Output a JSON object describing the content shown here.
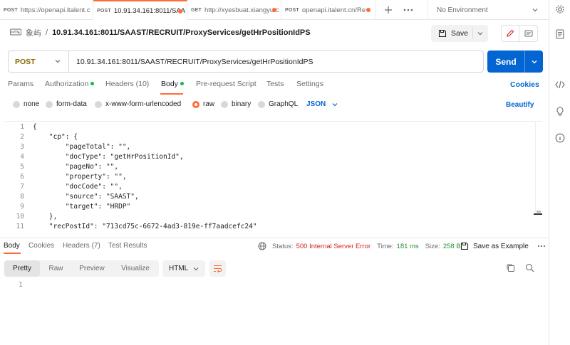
{
  "tabs": [
    {
      "method": "POST",
      "title": "https://openapi.italent.c"
    },
    {
      "method": "POST",
      "title": "10.91.34.161:8011/SAA"
    },
    {
      "method": "GET",
      "title": "http://xyesbuat.xiangyu.c"
    },
    {
      "method": "POST",
      "title": "openapi.italent.cn/Re"
    }
  ],
  "tabbar": {
    "add_icon": "plus-icon",
    "more_icon": "ellipsis-icon",
    "environment": "No Environment"
  },
  "breadcrumb": {
    "collection": "象屿",
    "separator": "/",
    "request": "10.91.34.161:8011/SAAST/RECRUIT/ProxyServices/getHrPositionIdPS"
  },
  "toolbar": {
    "save_label": "Save"
  },
  "request": {
    "method": "POST",
    "url": "10.91.34.161:8011/SAAST/RECRUIT/ProxyServices/getHrPositionIdPS",
    "send_label": "Send"
  },
  "request_tabs": [
    {
      "label": "Params"
    },
    {
      "label": "Authorization"
    },
    {
      "label": "Headers (10)"
    },
    {
      "label": "Body"
    },
    {
      "label": "Pre-request Script"
    },
    {
      "label": "Tests"
    },
    {
      "label": "Settings"
    }
  ],
  "cookies_label": "Cookies",
  "body_types": [
    {
      "label": "none"
    },
    {
      "label": "form-data"
    },
    {
      "label": "x-www-form-urlencoded"
    },
    {
      "label": "raw"
    },
    {
      "label": "binary"
    },
    {
      "label": "GraphQL"
    }
  ],
  "body_format": "JSON",
  "beautify_label": "Beautify",
  "editor": {
    "line_numbers": [
      "1",
      "2",
      "3",
      "4",
      "5",
      "6",
      "7",
      "8",
      "9",
      "10",
      "11"
    ],
    "lines": [
      "{",
      "    \"cp\": {",
      "        \"pageTotal\": \"\",",
      "        \"docType\": \"getHrPositionId\",",
      "        \"pageNo\": \"\",",
      "        \"property\": \"\",",
      "        \"docCode\": \"\",",
      "        \"source\": \"SAAST\",",
      "        \"target\": \"HRDP\"",
      "    },",
      "    \"recPostId\": \"713cd75c-6672-4ad3-819e-ff7aadcefc24\""
    ]
  },
  "response": {
    "tabs": [
      {
        "label": "Body"
      },
      {
        "label": "Cookies"
      },
      {
        "label": "Headers (7)"
      },
      {
        "label": "Test Results"
      }
    ],
    "status_label": "Status:",
    "status_value": "500 Internal Server Error",
    "time_label": "Time:",
    "time_value": "181 ms",
    "size_label": "Size:",
    "size_value": "258 B",
    "save_example": "Save as Example",
    "view_modes": [
      "Pretty",
      "Raw",
      "Preview",
      "Visualize"
    ],
    "format": "HTML",
    "line_number": "1"
  },
  "colors": {
    "accent": "#ff6c37",
    "primary": "#0265d2",
    "error": "#d0261c",
    "method_post": "#8a6b00"
  }
}
